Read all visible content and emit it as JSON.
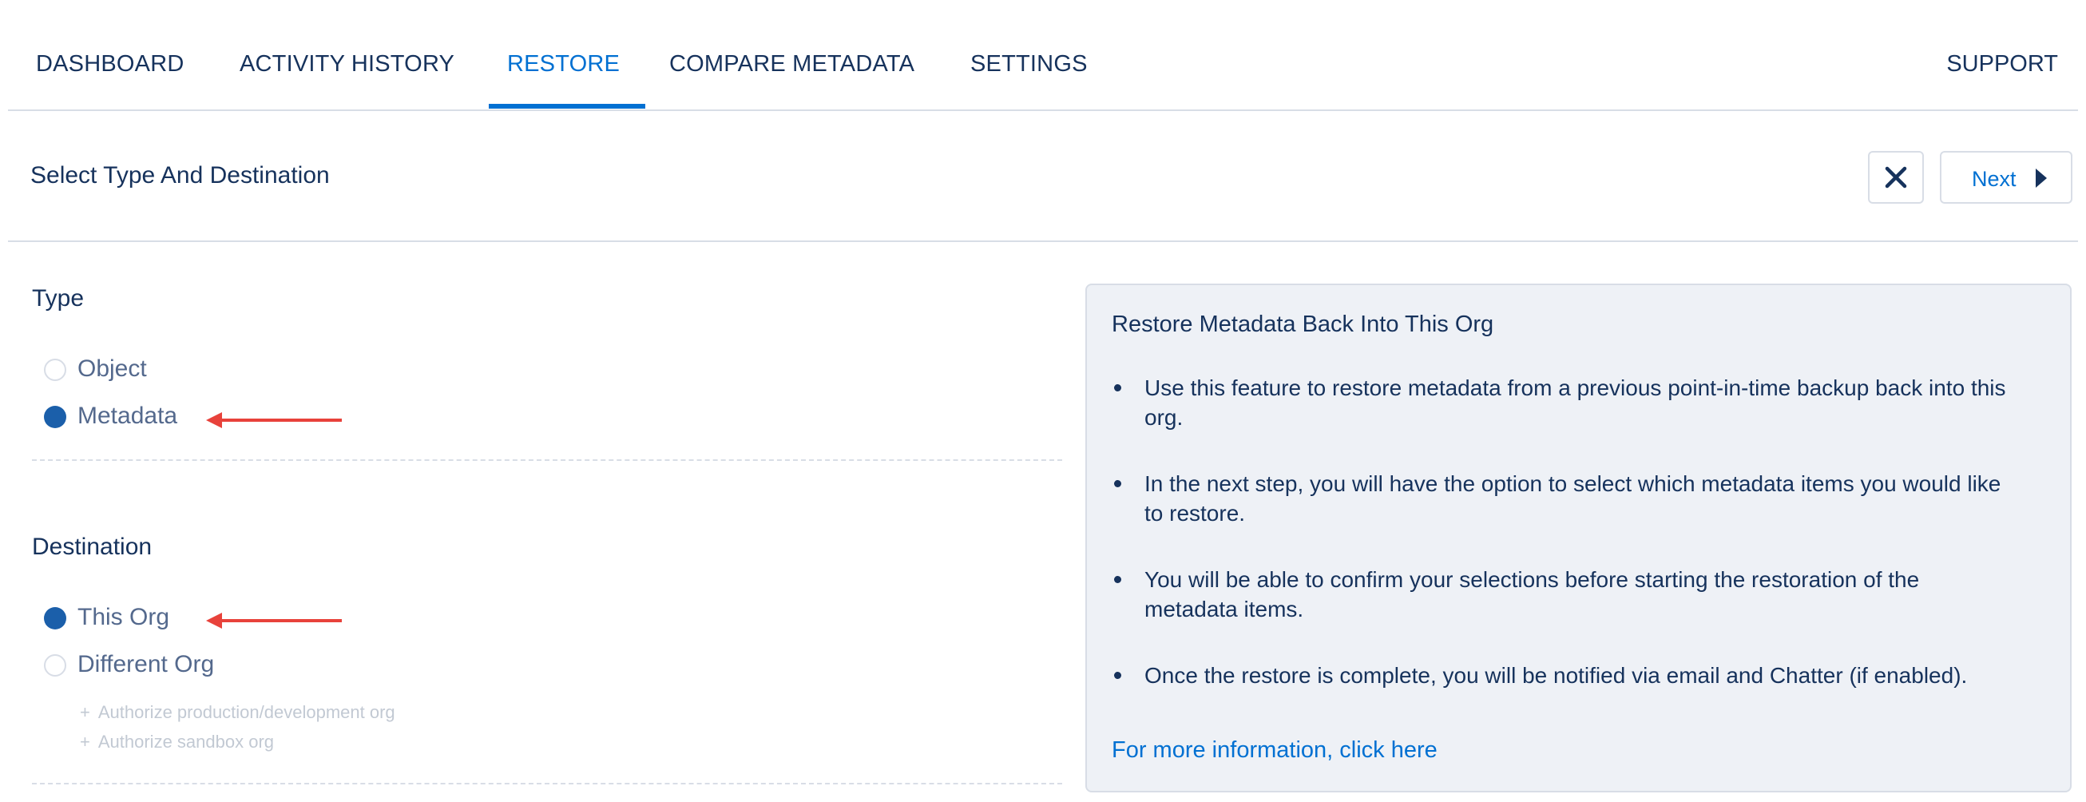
{
  "nav": {
    "tabs": [
      {
        "label": "DASHBOARD"
      },
      {
        "label": "ACTIVITY HISTORY"
      },
      {
        "label": "RESTORE"
      },
      {
        "label": "COMPARE METADATA"
      },
      {
        "label": "SETTINGS"
      }
    ],
    "active_tab": "RESTORE",
    "support_label": "SUPPORT"
  },
  "header": {
    "title": "Select Type And Destination",
    "close_icon": "close-icon",
    "next_label": "Next"
  },
  "type_section": {
    "title": "Type",
    "options": [
      {
        "label": "Object",
        "selected": false
      },
      {
        "label": "Metadata",
        "selected": true
      }
    ]
  },
  "destination_section": {
    "title": "Destination",
    "options": [
      {
        "label": "This Org",
        "selected": true
      },
      {
        "label": "Different Org",
        "selected": false
      }
    ],
    "auth_links": [
      {
        "label": "Authorize production/development org"
      },
      {
        "label": "Authorize sandbox org"
      }
    ]
  },
  "info_panel": {
    "title": "Restore Metadata Back Into This Org",
    "bullets": [
      {
        "text": "Use this feature to restore metadata from a previous point-in-time backup back into this org."
      },
      {
        "text": "In the next step, you will have the option to select which metadata items you would like to restore."
      },
      {
        "text": "You will be able to confirm your selections before starting the restoration of the metadata items."
      },
      {
        "text": "Once the restore is complete, you will be notified via email and Chatter (if enabled)."
      }
    ],
    "more_link": "For more information, click here"
  },
  "colors": {
    "accent": "#0070d2",
    "text": "#16325c",
    "radio_selected": "#1b5faa",
    "annotation_arrow": "#e8423b",
    "panel_bg": "#eef1f6"
  }
}
